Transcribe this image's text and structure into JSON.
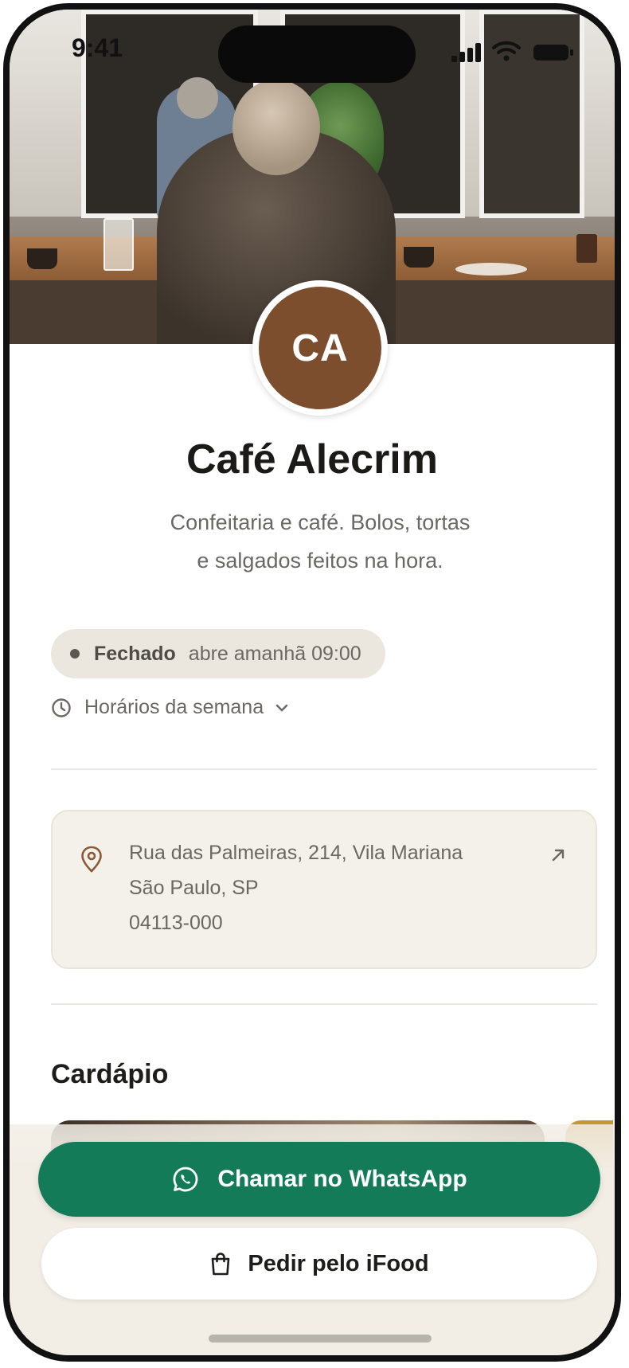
{
  "status_bar": {
    "time": "9:41"
  },
  "profile": {
    "initials": "CA",
    "name": "Café Alecrim",
    "description_line1": "Confeitaria e café. Bolos, tortas",
    "description_line2": "e salgados feitos na hora."
  },
  "open_status": {
    "state": "Fechado",
    "next_open": "abre amanhã 09:00"
  },
  "hours_toggle": {
    "label": "Horários da semana"
  },
  "address": {
    "line1": "Rua das Palmeiras, 214, Vila Mariana",
    "line2": "São Paulo, SP",
    "line3": "04113-000"
  },
  "menu_section": {
    "title": "Cardápio"
  },
  "actions": {
    "whatsapp_label": "Chamar no WhatsApp",
    "ifood_label": "Pedir pelo iFood"
  },
  "colors": {
    "brand_brown": "#7c4e2e",
    "whatsapp_green": "#137b57",
    "surface_beige": "#f4f1ea"
  }
}
